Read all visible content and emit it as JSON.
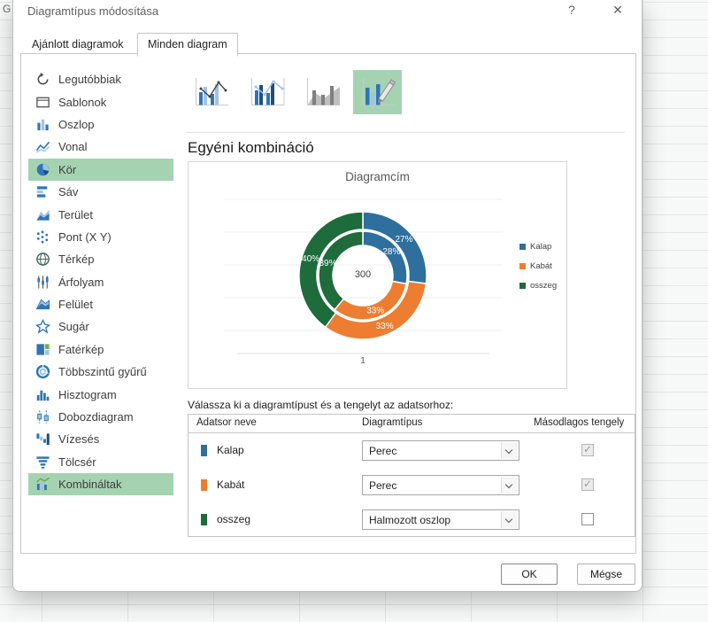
{
  "window": {
    "title": "Diagramtípus módosítása",
    "help_label": "?",
    "close_label": "✕"
  },
  "background": {
    "corner_letter": "G"
  },
  "tabs": [
    {
      "label": "Ajánlott diagramok",
      "active": false
    },
    {
      "label": "Minden diagram",
      "active": true
    }
  ],
  "sidebar": {
    "items": [
      {
        "label": "Legutóbbiak",
        "icon": "recent-icon",
        "selected": false
      },
      {
        "label": "Sablonok",
        "icon": "templates-icon",
        "selected": false
      },
      {
        "label": "Oszlop",
        "icon": "column-chart-icon",
        "selected": false
      },
      {
        "label": "Vonal",
        "icon": "line-chart-icon",
        "selected": false
      },
      {
        "label": "Kör",
        "icon": "pie-chart-icon",
        "selected": true
      },
      {
        "label": "Sáv",
        "icon": "bar-chart-icon",
        "selected": false
      },
      {
        "label": "Terület",
        "icon": "area-chart-icon",
        "selected": false
      },
      {
        "label": "Pont (X Y)",
        "icon": "scatter-chart-icon",
        "selected": false
      },
      {
        "label": "Térkép",
        "icon": "map-chart-icon",
        "selected": false
      },
      {
        "label": "Árfolyam",
        "icon": "stock-chart-icon",
        "selected": false
      },
      {
        "label": "Felület",
        "icon": "surface-chart-icon",
        "selected": false
      },
      {
        "label": "Sugár",
        "icon": "radar-chart-icon",
        "selected": false
      },
      {
        "label": "Fatérkép",
        "icon": "treemap-chart-icon",
        "selected": false
      },
      {
        "label": "Többszintű gyűrű",
        "icon": "sunburst-chart-icon",
        "selected": false
      },
      {
        "label": "Hisztogram",
        "icon": "histogram-chart-icon",
        "selected": false
      },
      {
        "label": "Dobozdiagram",
        "icon": "boxwhisker-chart-icon",
        "selected": false
      },
      {
        "label": "Vízesés",
        "icon": "waterfall-chart-icon",
        "selected": false
      },
      {
        "label": "Tölcsér",
        "icon": "funnel-chart-icon",
        "selected": false
      },
      {
        "label": "Kombináltak",
        "icon": "combo-chart-icon",
        "selected": true
      }
    ]
  },
  "subtype_thumbnails": [
    {
      "name": "clustered-column-line",
      "selected": false
    },
    {
      "name": "clustered-column-line-secondary-axis",
      "selected": false
    },
    {
      "name": "stacked-area-clustered-column",
      "selected": false
    },
    {
      "name": "custom-combination",
      "selected": true
    }
  ],
  "section_heading": "Egyéni kombináció",
  "chart_data": {
    "type": "doughnut",
    "title": "Diagramcím",
    "center_label": "300",
    "category_axis_label": "1",
    "segment_colors": [
      "#2e6f9e",
      "#ed7d31",
      "#1e6b3c"
    ],
    "rings": [
      {
        "name": "outer",
        "values": [
          27,
          33,
          40
        ],
        "labels": [
          "27%",
          "33%",
          "40%"
        ]
      },
      {
        "name": "inner",
        "values": [
          28,
          33,
          39
        ],
        "labels": [
          "28%",
          "33%",
          "39%"
        ]
      }
    ],
    "legend": [
      {
        "label": "Kalap",
        "color": "#2e6f9e"
      },
      {
        "label": "Kabát",
        "color": "#ed7d31"
      },
      {
        "label": "osszeg",
        "color": "#1e6b3c"
      }
    ],
    "legend_position": "right",
    "grid": true
  },
  "series_table": {
    "prompt": "Válassza ki a diagramtípust és a tengelyt az adatsorhoz:",
    "headers": [
      "Adatsor neve",
      "Diagramtípus",
      "Másodlagos tengely"
    ],
    "rows": [
      {
        "name": "Kalap",
        "color": "#2e6f9e",
        "chart_type": "Perec",
        "secondary_axis": true,
        "checkbox_disabled": true
      },
      {
        "name": "Kabát",
        "color": "#ed7d31",
        "chart_type": "Perec",
        "secondary_axis": true,
        "checkbox_disabled": true
      },
      {
        "name": "osszeg",
        "color": "#1e6b3c",
        "chart_type": "Halmozott oszlop",
        "secondary_axis": false,
        "checkbox_disabled": false
      }
    ]
  },
  "buttons": {
    "ok": "OK",
    "cancel": "Mégse"
  }
}
